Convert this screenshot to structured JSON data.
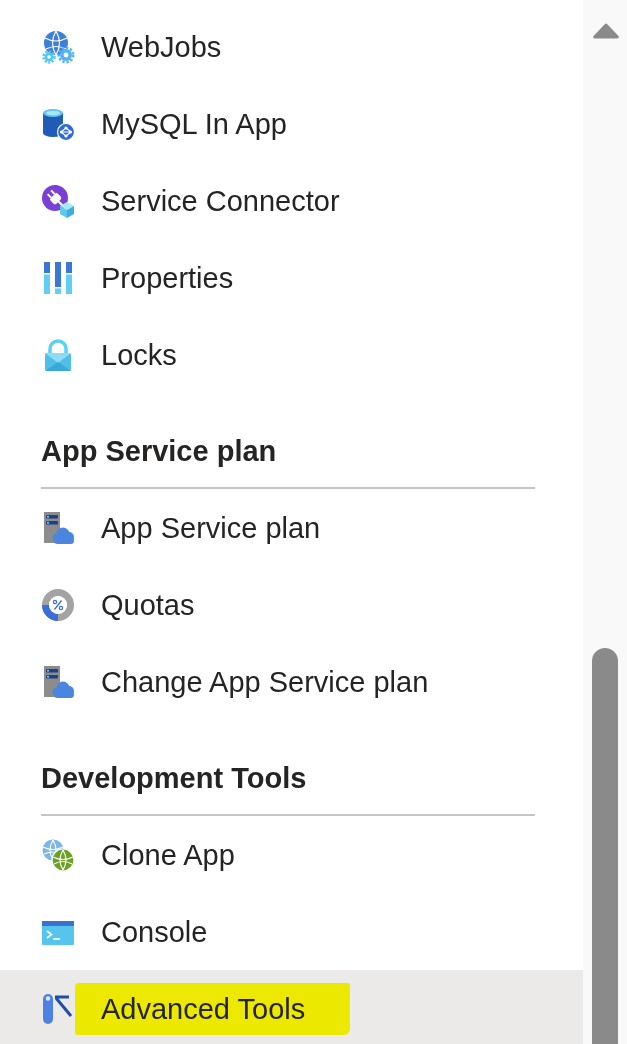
{
  "sections": [
    {
      "items": [
        {
          "kind": "webjobs",
          "label": "WebJobs",
          "selected": false,
          "highlighted": false
        },
        {
          "kind": "database",
          "label": "MySQL In App",
          "selected": false,
          "highlighted": false
        },
        {
          "kind": "connector",
          "label": "Service Connector",
          "selected": false,
          "highlighted": false
        },
        {
          "kind": "properties",
          "label": "Properties",
          "selected": false,
          "highlighted": false
        },
        {
          "kind": "lock",
          "label": "Locks",
          "selected": false,
          "highlighted": false
        }
      ]
    },
    {
      "title": "App Service plan",
      "items": [
        {
          "kind": "plan",
          "label": "App Service plan",
          "selected": false,
          "highlighted": false
        },
        {
          "kind": "quotas",
          "label": "Quotas",
          "selected": false,
          "highlighted": false
        },
        {
          "kind": "plan",
          "label": "Change App Service plan",
          "selected": false,
          "highlighted": false
        }
      ]
    },
    {
      "title": "Development Tools",
      "items": [
        {
          "kind": "clone",
          "label": "Clone App",
          "selected": false,
          "highlighted": false
        },
        {
          "kind": "console",
          "label": "Console",
          "selected": false,
          "highlighted": false
        },
        {
          "kind": "tools",
          "label": "Advanced Tools",
          "selected": true,
          "highlighted": true
        }
      ]
    }
  ]
}
